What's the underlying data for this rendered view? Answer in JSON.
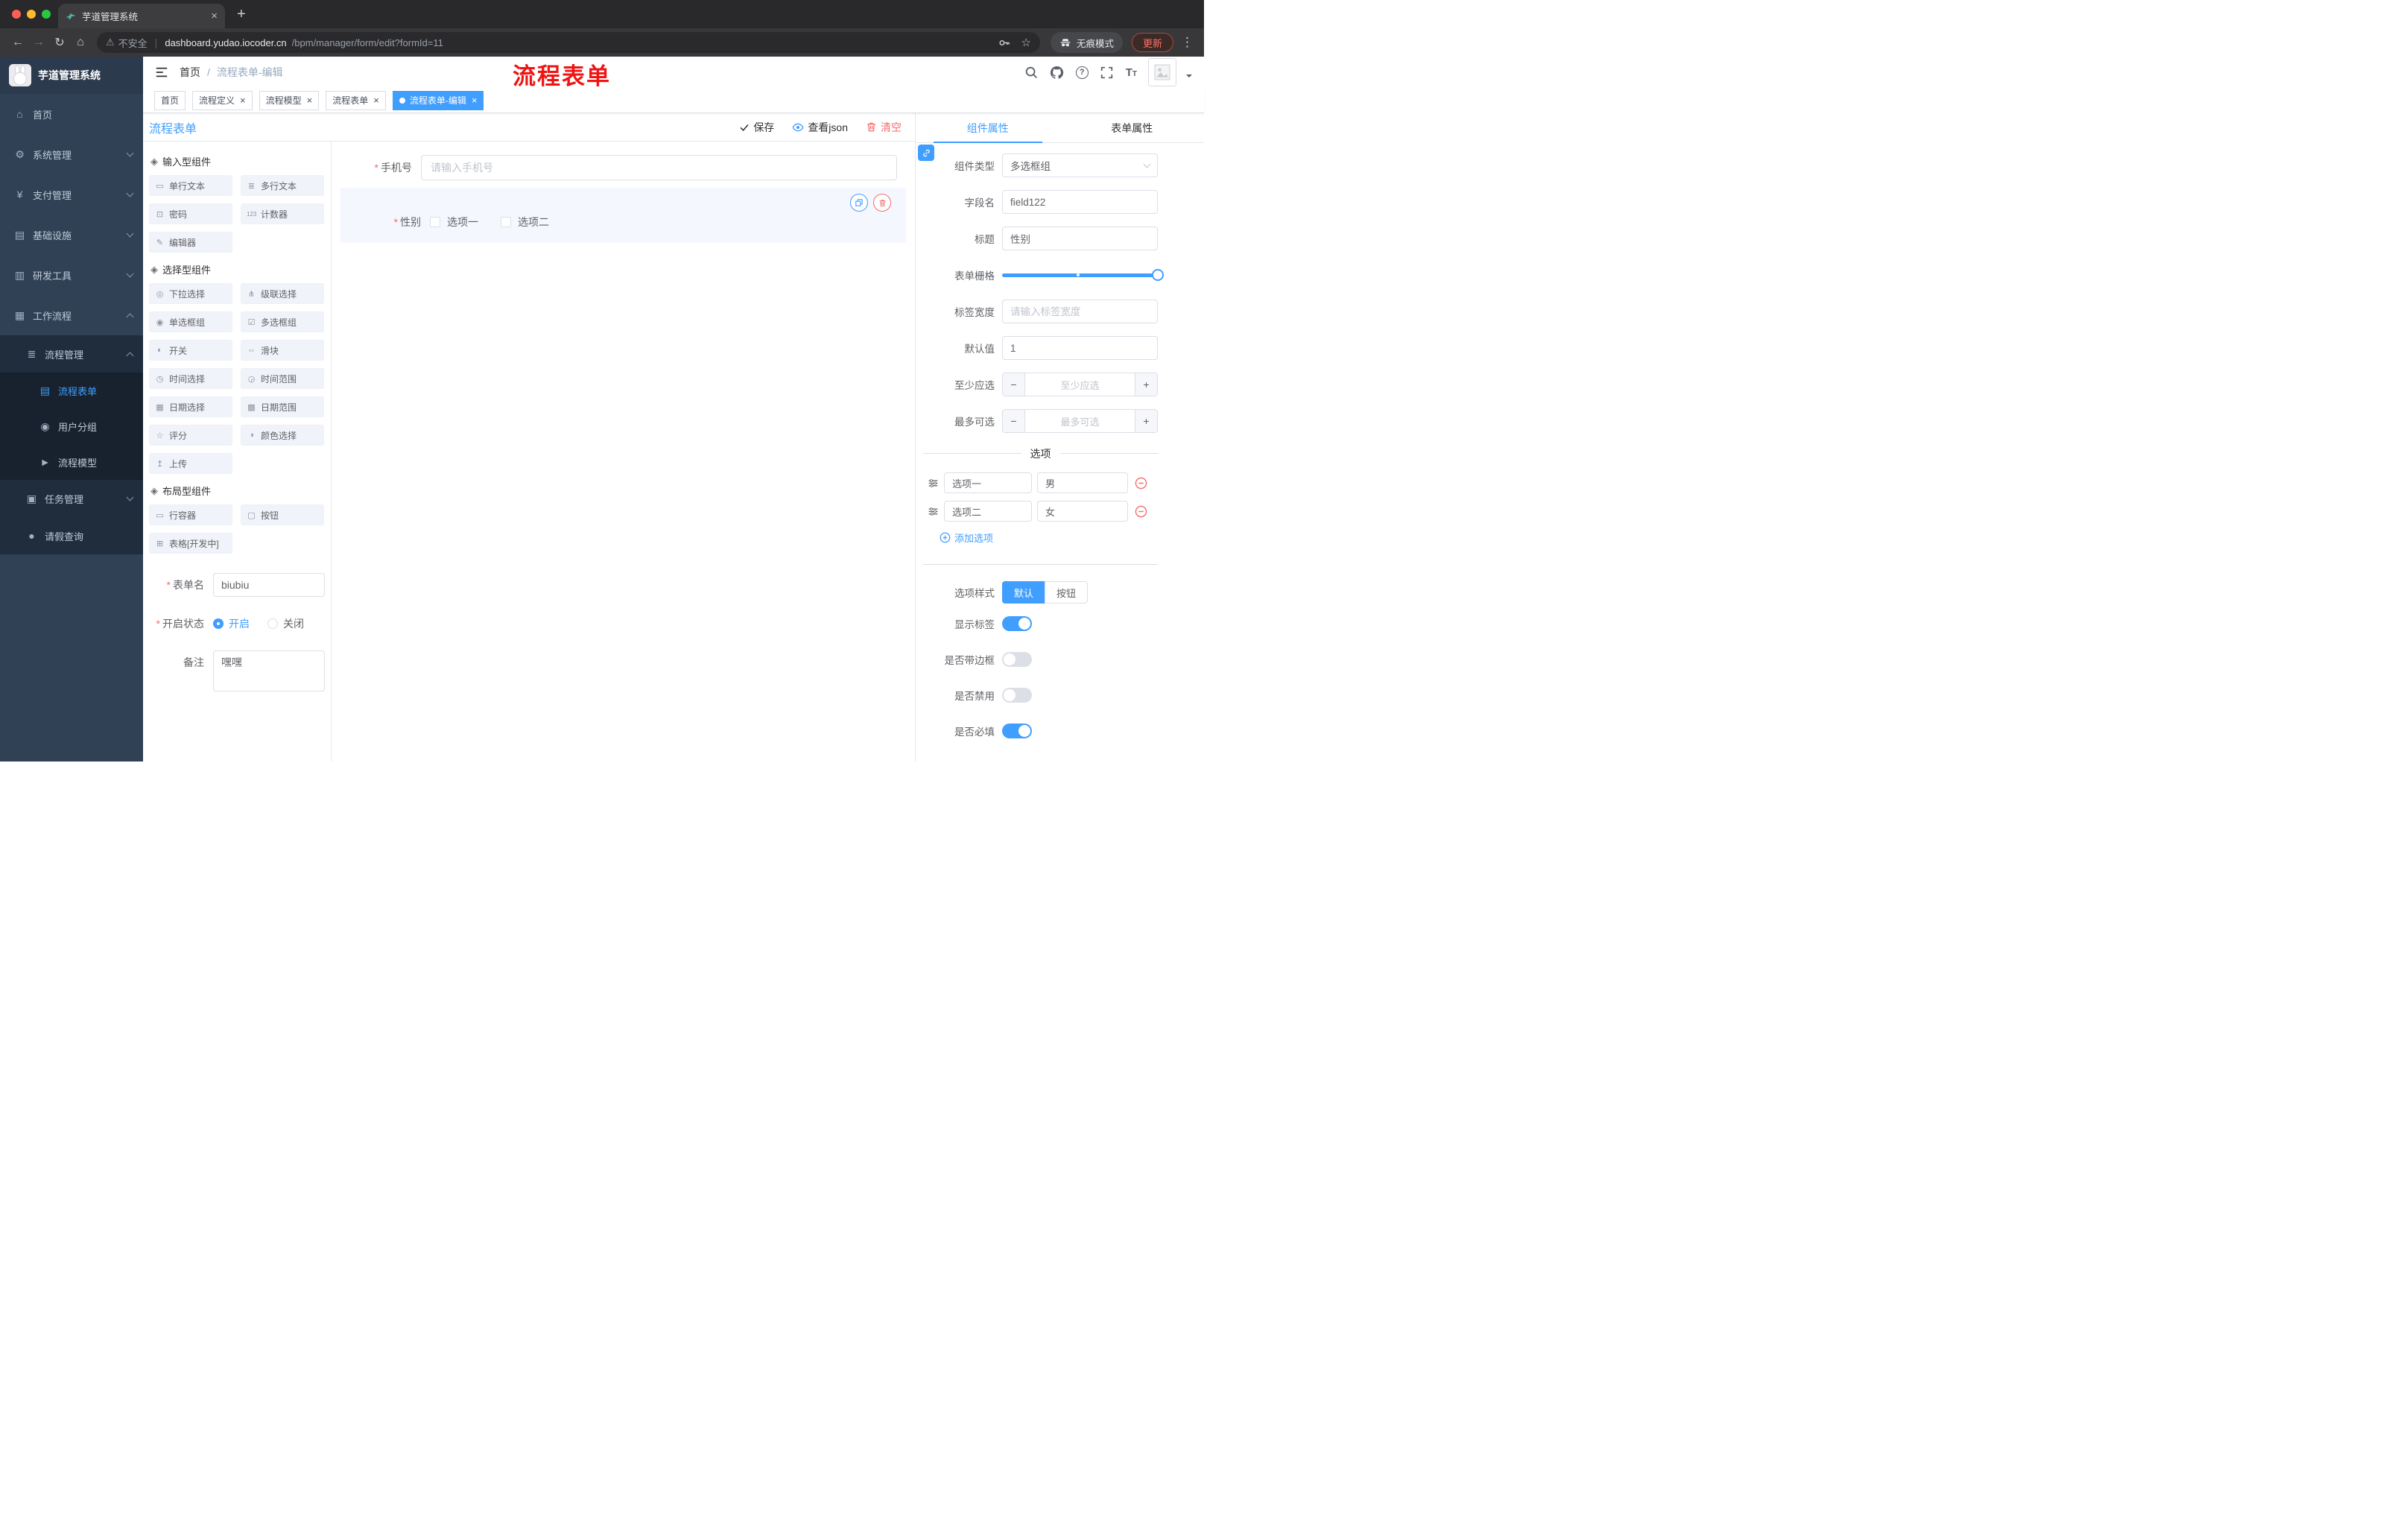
{
  "colors": {
    "primary": "#409eff",
    "danger": "#f56c6c",
    "sidebar_bg": "#304156",
    "submenu_bg": "#1f2d3d",
    "active_tag": "#409eff",
    "annotation": "#ee1414"
  },
  "browser": {
    "tab_title": "芋道管理系统",
    "security_label": "不安全",
    "url_host": "dashboard.yudao.iocoder.cn",
    "url_path": "/bpm/manager/form/edit?formId=11",
    "incognito_label": "无痕模式",
    "update_label": "更新"
  },
  "annotation": "流程表单",
  "sidebar": {
    "logo_title": "芋道管理系统",
    "menu": [
      {
        "label": "首页"
      },
      {
        "label": "系统管理"
      },
      {
        "label": "支付管理"
      },
      {
        "label": "基础设施"
      },
      {
        "label": "研发工具"
      },
      {
        "label": "工作流程"
      },
      {
        "label": "流程管理"
      },
      {
        "label": "流程表单"
      },
      {
        "label": "用户分组"
      },
      {
        "label": "流程模型"
      },
      {
        "label": "任务管理"
      },
      {
        "label": "请假查询"
      }
    ]
  },
  "header": {
    "breadcrumb_home": "首页",
    "breadcrumb_current": "流程表单-编辑"
  },
  "tags": [
    {
      "label": "首页"
    },
    {
      "label": "流程定义"
    },
    {
      "label": "流程模型"
    },
    {
      "label": "流程表单"
    },
    {
      "label": "流程表单-编辑"
    }
  ],
  "designer": {
    "panel_title": "流程表单",
    "save": "保存",
    "view_json": "查看json",
    "clear": "清空",
    "sections": [
      {
        "title": "输入型组件",
        "items": [
          "单行文本",
          "多行文本",
          "密码",
          "计数器",
          "编辑器"
        ]
      },
      {
        "title": "选择型组件",
        "items": [
          "下拉选择",
          "级联选择",
          "单选框组",
          "多选框组",
          "开关",
          "滑块",
          "时间选择",
          "时间范围",
          "日期选择",
          "日期范围",
          "评分",
          "颜色选择",
          "上传"
        ]
      },
      {
        "title": "布局型组件",
        "items": [
          "行容器",
          "按钮",
          "表格[开发中]"
        ]
      }
    ],
    "form": {
      "name_label": "表单名",
      "name_value": "biubiu",
      "status_label": "开启状态",
      "status_on": "开启",
      "status_off": "关闭",
      "remark_label": "备注",
      "remark_value": "嘿嘿"
    },
    "canvas": {
      "phone_label": "手机号",
      "phone_placeholder": "请输入手机号",
      "gender_label": "性别",
      "gender_option1": "选项一",
      "gender_option2": "选项二"
    }
  },
  "props": {
    "tab_component": "组件属性",
    "tab_form": "表单属性",
    "type_label": "组件类型",
    "type_value": "多选框组",
    "field_label": "字段名",
    "field_value": "field122",
    "title_label": "标题",
    "title_value": "性别",
    "grid_label": "表单栅格",
    "width_label": "标签宽度",
    "width_placeholder": "请输入标签宽度",
    "default_label": "默认值",
    "default_value": "1",
    "min_label": "至少应选",
    "min_placeholder": "至少应选",
    "max_label": "最多可选",
    "max_placeholder": "最多可选",
    "options_divider": "选项",
    "options": [
      {
        "label": "选项一",
        "value": "男"
      },
      {
        "label": "选项二",
        "value": "女"
      }
    ],
    "add_option": "添加选项",
    "style_label": "选项样式",
    "style_default": "默认",
    "style_button": "按钮",
    "switch_show_label": "显示标签",
    "switch_border": "是否带边框",
    "switch_disabled": "是否禁用",
    "switch_required": "是否必填"
  }
}
